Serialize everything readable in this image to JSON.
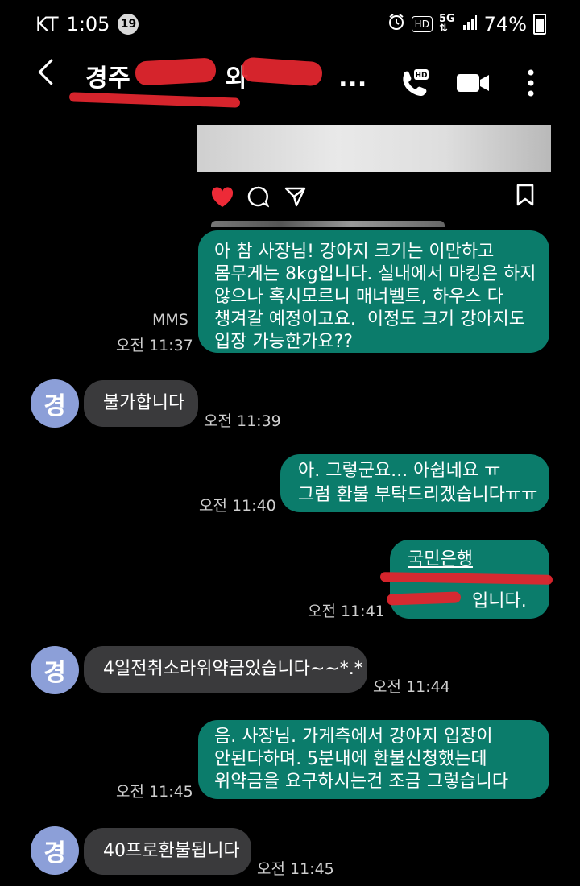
{
  "status_bar": {
    "carrier": "KT",
    "time": "1:05",
    "notification_count": "19",
    "battery": "74%",
    "icons": [
      "alarm-icon",
      "hd-icon",
      "5g-icon",
      "signal-icon",
      "battery-icon"
    ]
  },
  "header": {
    "title": "경주 와 ...",
    "title_start": "경주",
    "title_mid": "와",
    "title_end": "...",
    "icons": [
      "back-icon",
      "hd-voice-call-icon",
      "video-call-icon",
      "more-icon"
    ]
  },
  "shared_post": {
    "icons": [
      "heart-icon",
      "comment-icon",
      "send-icon",
      "bookmark-icon"
    ]
  },
  "messages": [
    {
      "direction": "outgoing",
      "lines": [
        "아 참 사장님! 강아지 크기는 이만하고",
        "몸무게는 8kg입니다. 실내에서 마킹은 하지",
        "않으나 혹시모르니 매너벨트, 하우스 다",
        "챙겨갈 예정이고요.  이정도 크기 강아지도",
        "입장 가능한가요??"
      ],
      "type_label": "MMS",
      "time": "오전 11:37"
    },
    {
      "direction": "incoming",
      "avatar": "경",
      "text": "불가합니다",
      "time": "오전 11:39"
    },
    {
      "direction": "outgoing",
      "lines": [
        "아. 그렇군요... 아쉽네요 ㅠ",
        "그럼 환불 부탁드리겠습니다ㅠㅠ"
      ],
      "time": "오전 11:40"
    },
    {
      "direction": "outgoing",
      "lines": [
        "국민은행",
        "",
        "입니다."
      ],
      "time": "오전 11:41"
    },
    {
      "direction": "incoming",
      "avatar": "경",
      "text": "4일전취소라위약금있습니다~~*.*",
      "time": "오전 11:44"
    },
    {
      "direction": "outgoing",
      "lines": [
        "음. 사장님. 가게측에서 강아지 입장이",
        "안된다하며. 5분내에 환불신청했는데",
        "위약금을 요구하시는건 조금 그렇습니다"
      ],
      "time": "오전 11:45"
    },
    {
      "direction": "incoming",
      "avatar": "경",
      "text": "40프로환불됩니다",
      "time": "오전 11:45"
    }
  ],
  "colors": {
    "background": "#000000",
    "outgoing_bubble": "#0b7c6b",
    "incoming_bubble": "#3a3a3c",
    "avatar": "#8c9fd8",
    "redaction": "#e0262e"
  }
}
